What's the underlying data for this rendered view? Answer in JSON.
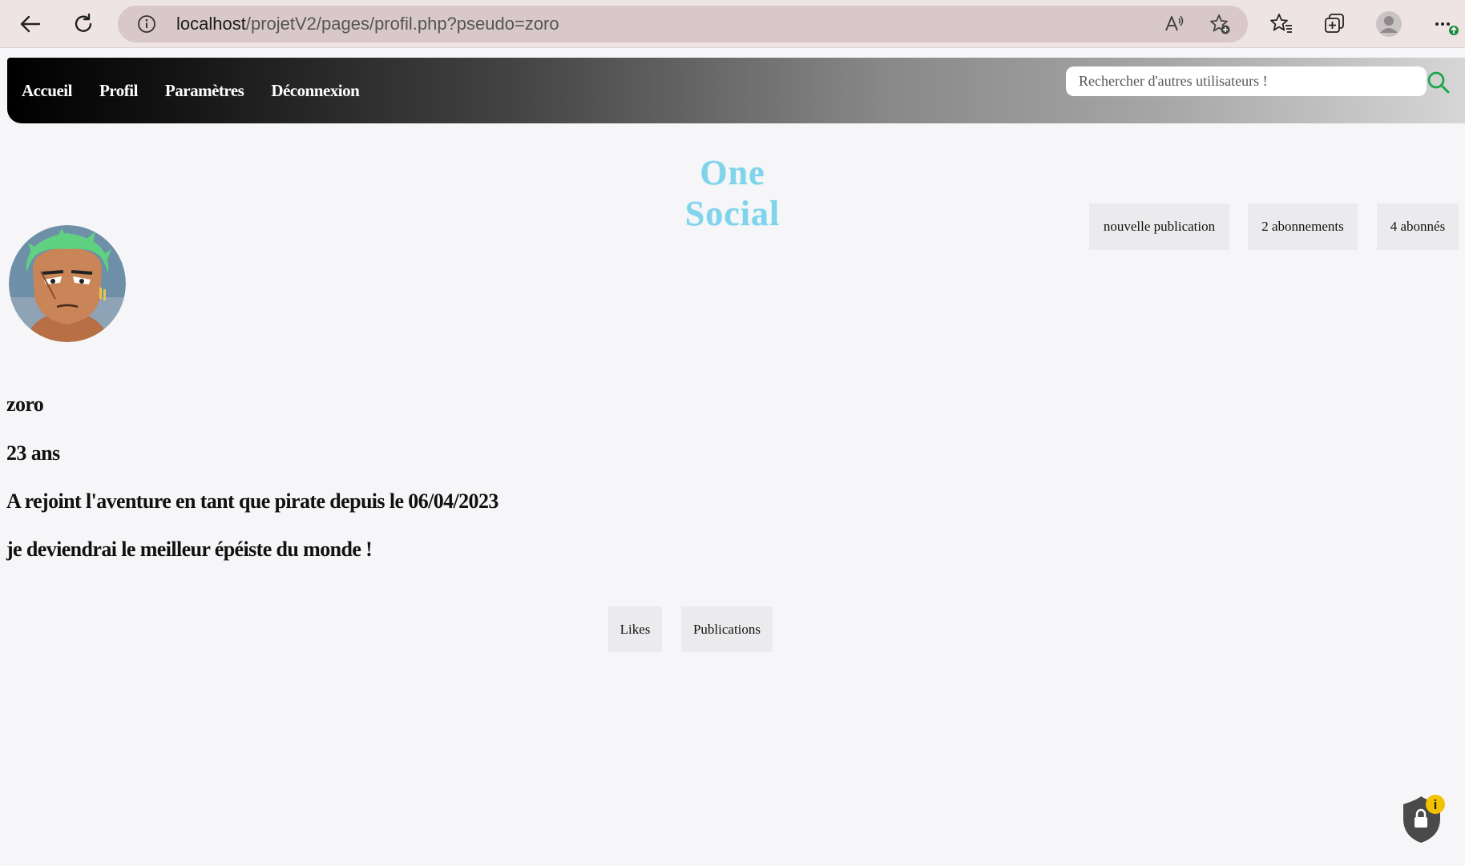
{
  "browser": {
    "url_host": "localhost",
    "url_path": "/projetV2/pages/profil.php?pseudo=zoro",
    "icons": [
      "back-arrow-icon",
      "refresh-icon",
      "info-icon",
      "read-aloud-icon",
      "add-favorite-icon",
      "favorites-icon",
      "collections-icon",
      "profile-icon",
      "more-icon"
    ]
  },
  "nav": {
    "links": [
      "Accueil",
      "Profil",
      "Paramètres",
      "Déconnexion"
    ],
    "search_placeholder": "Rechercher d'autres utilisateurs !"
  },
  "logo": {
    "text": "One Social",
    "color": "#7fd3ea"
  },
  "actions": {
    "new_post": "nouvelle publication",
    "following": "2 abonnements",
    "followers": "4 abonnés"
  },
  "profile": {
    "username": "zoro",
    "age": "23 ans",
    "joined": "A rejoint l'aventure en tant que pirate depuis le 06/04/2023",
    "bio": "je deviendrai le meilleur épéiste du monde !"
  },
  "tabs": {
    "likes": "Likes",
    "posts": "Publications"
  },
  "colors": {
    "page_bg": "#f6f6f8",
    "chrome_bg": "#efe4e4",
    "address_bg": "#d9c8c9",
    "button_bg": "#ebebed",
    "search_icon": "#1aa84a"
  }
}
